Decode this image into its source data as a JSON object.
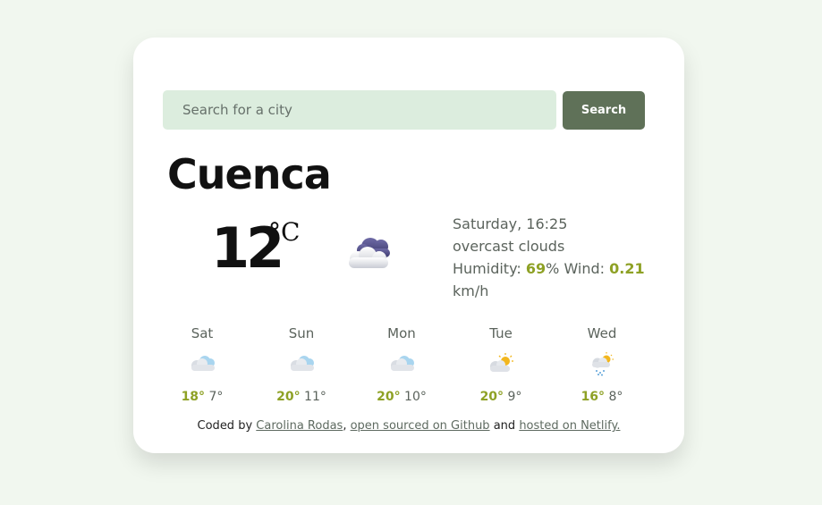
{
  "search": {
    "placeholder": "Search for a city",
    "button_label": "Search"
  },
  "current": {
    "city": "Cuenca",
    "temperature": "12",
    "unit": "°C",
    "datetime": "Saturday, 16:25",
    "description": "overcast clouds",
    "humidity_label": "Humidity:",
    "humidity_value": "69",
    "humidity_unit": "%",
    "wind_label": "Wind:",
    "wind_value": "0.21",
    "wind_unit": "km/h",
    "icon": "overcast-clouds-icon"
  },
  "forecast": [
    {
      "day": "Sat",
      "max": "18°",
      "min": "7°",
      "icon": "light-clouds-icon"
    },
    {
      "day": "Sun",
      "max": "20°",
      "min": "11°",
      "icon": "light-clouds-icon"
    },
    {
      "day": "Mon",
      "max": "20°",
      "min": "10°",
      "icon": "light-clouds-icon"
    },
    {
      "day": "Tue",
      "max": "20°",
      "min": "9°",
      "icon": "partly-sunny-icon"
    },
    {
      "day": "Wed",
      "max": "16°",
      "min": "8°",
      "icon": "sun-rain-icon"
    }
  ],
  "footer": {
    "prefix": "Coded by",
    "author_link": "Carolina Rodas",
    "comma": ",",
    "github_link": "open sourced on Github",
    "and": "and",
    "netlify_link": "hosted on Netlify."
  },
  "colors": {
    "background": "#f1f7ef",
    "search_field": "#dcedde",
    "search_button": "#5f7158",
    "accent": "#8ea125"
  }
}
